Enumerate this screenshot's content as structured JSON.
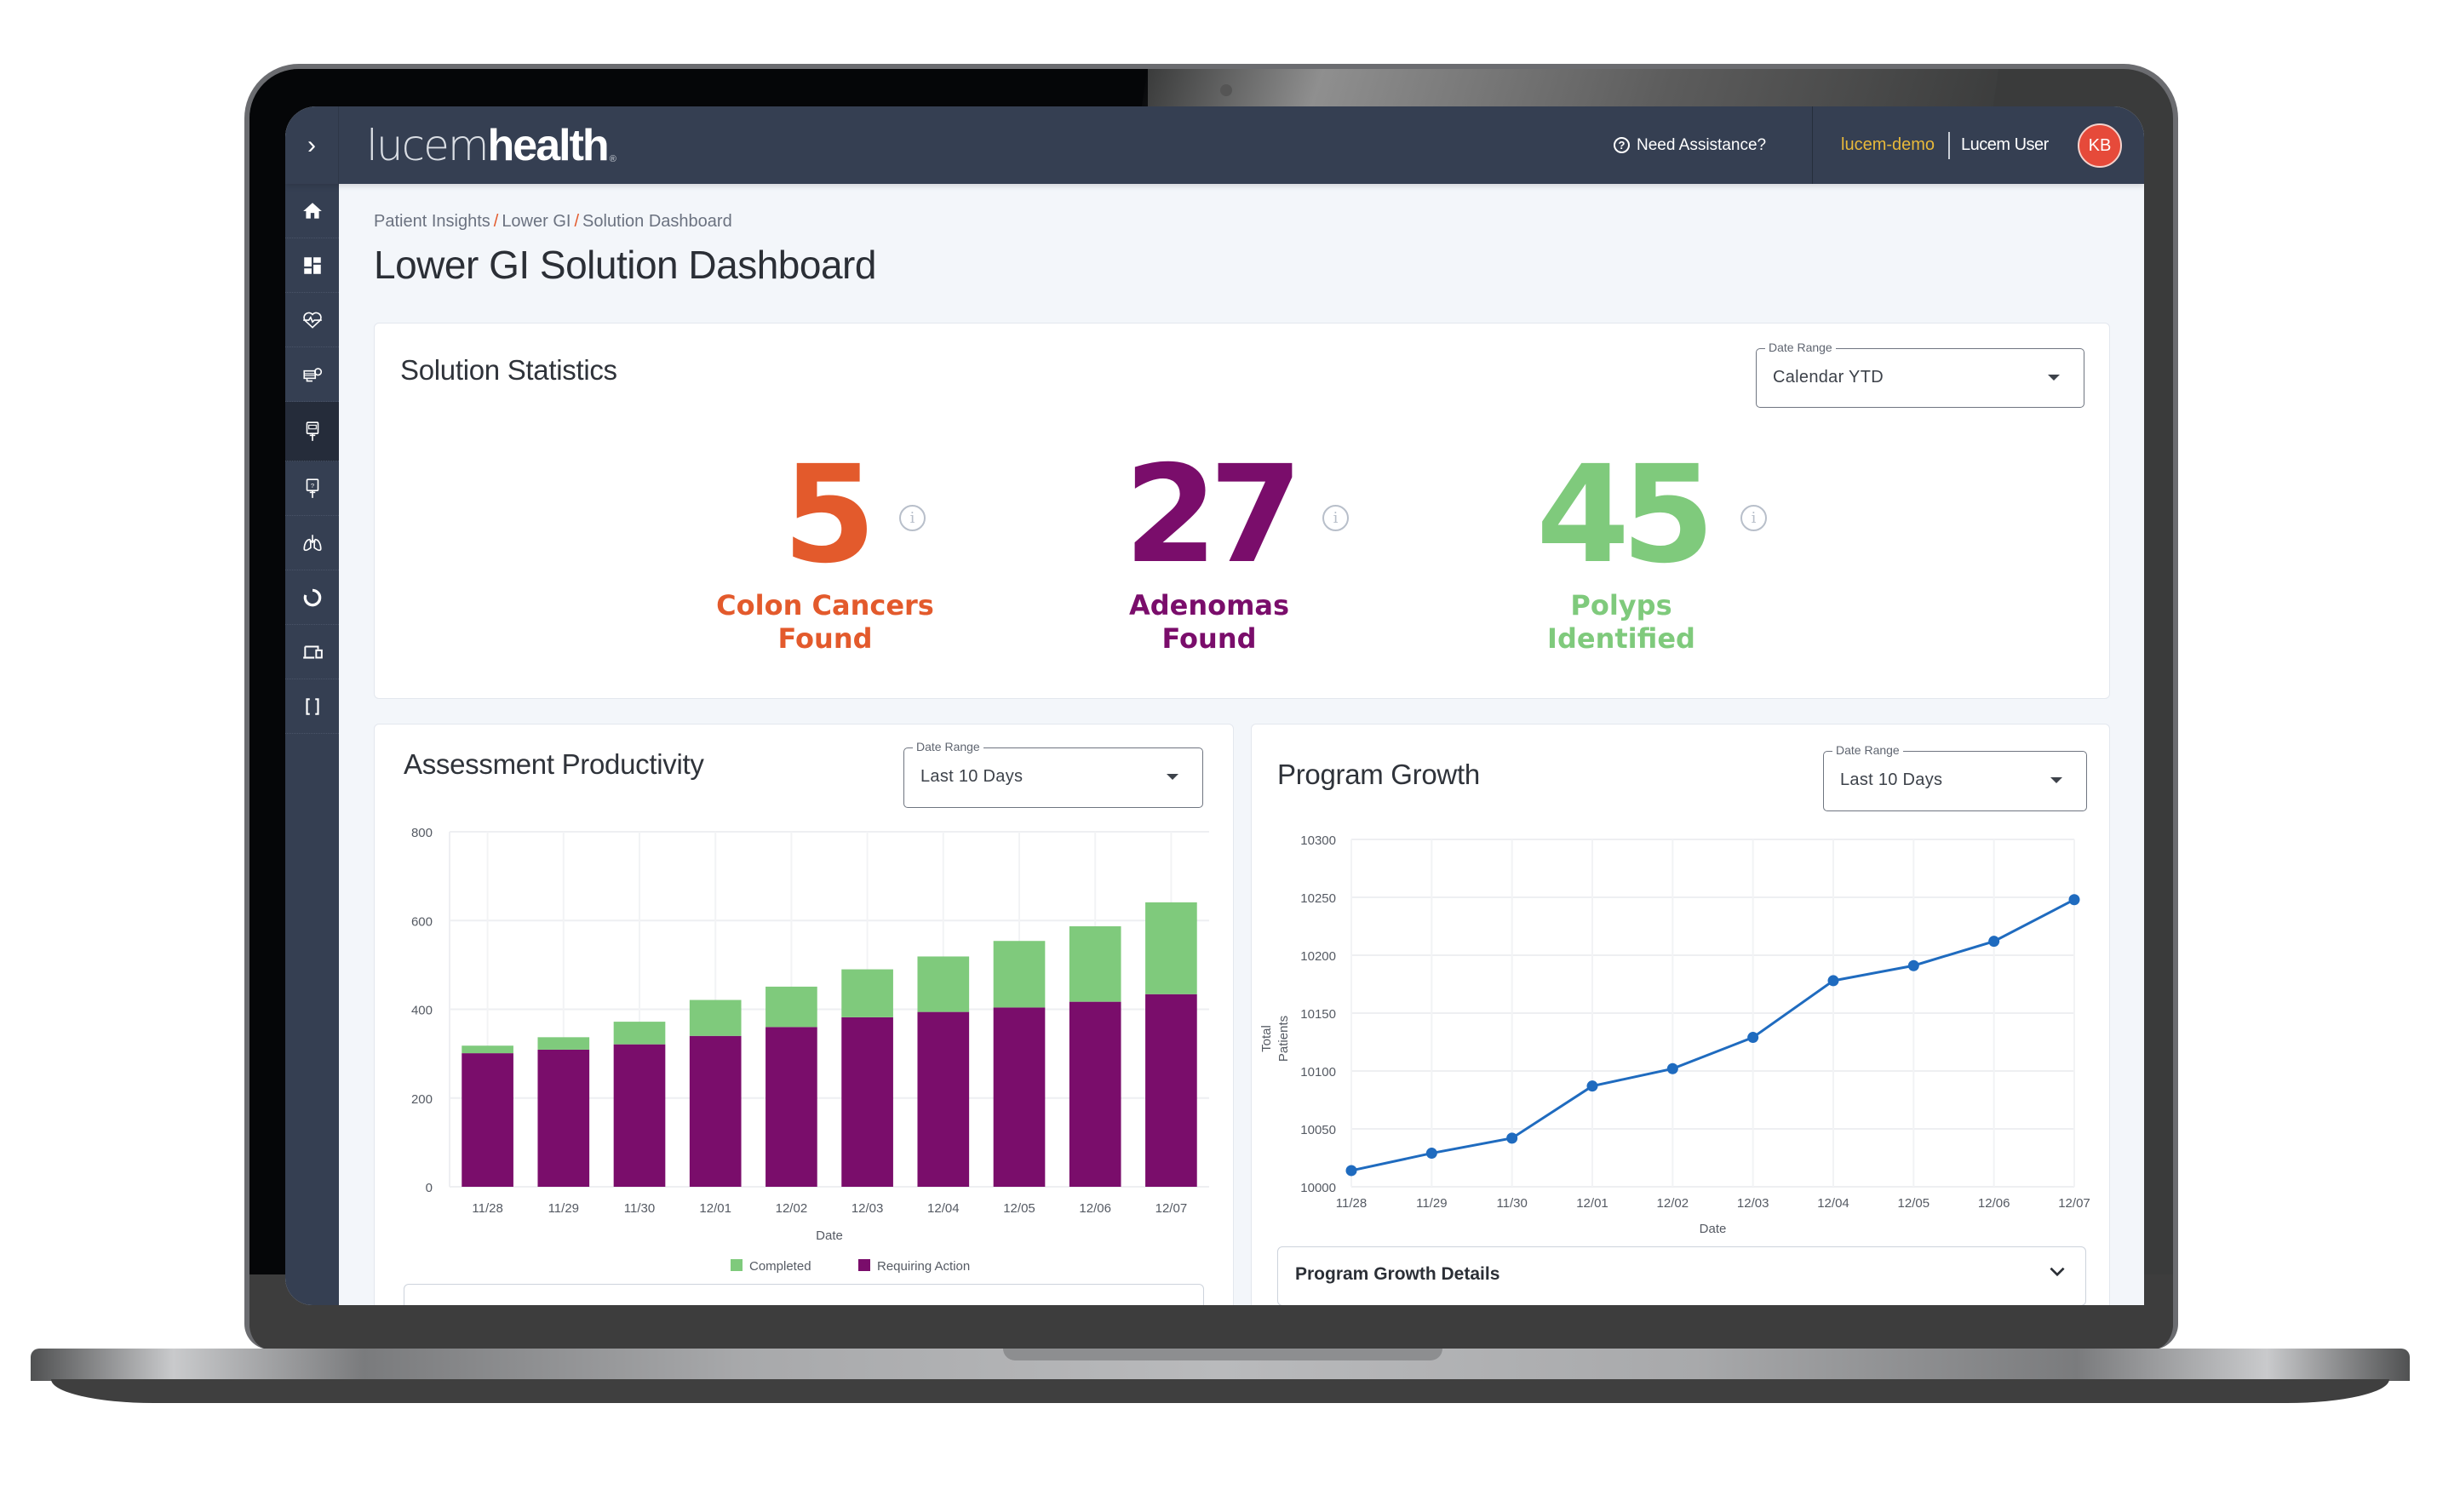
{
  "header": {
    "expand_icon": "chevron-right-icon",
    "logo_light": "lucem",
    "logo_bold": "health",
    "logo_mark": "®",
    "help_label": "Need Assistance?",
    "tenant": "lucem-demo",
    "user_name": "Lucem User",
    "avatar_initials": "KB"
  },
  "sidebar": {
    "items": [
      {
        "icon": "home-icon",
        "active": false
      },
      {
        "icon": "dashboard-icon",
        "active": false
      },
      {
        "icon": "heart-pulse-icon",
        "active": false
      },
      {
        "icon": "infusion-icon",
        "active": false
      },
      {
        "icon": "lower-gi-device-icon",
        "active": true
      },
      {
        "icon": "diagnostic-device-icon",
        "active": false
      },
      {
        "icon": "lungs-icon",
        "active": false
      },
      {
        "icon": "circle-progress-icon",
        "active": false
      },
      {
        "icon": "devices-icon",
        "active": false
      },
      {
        "icon": "brackets-icon",
        "active": false
      }
    ]
  },
  "breadcrumb": [
    "Patient Insights",
    "Lower GI",
    "Solution Dashboard"
  ],
  "breadcrumb_separator": "/",
  "page_title": "Lower GI Solution Dashboard",
  "colors": {
    "header_bg": "#353f52",
    "orange": "#e35a2c",
    "purple": "#7a0d6b",
    "green": "#7fca7c",
    "line_blue": "#1f6bbf",
    "tenant_gold": "#e8b93a",
    "avatar_red": "#e64a3a"
  },
  "solution_statistics": {
    "title": "Solution Statistics",
    "date_range": {
      "label": "Date Range",
      "value": "Calendar YTD"
    },
    "stats": [
      {
        "value": "5",
        "label_line1": "Colon Cancers",
        "label_line2": "Found",
        "color": "#e35a2c"
      },
      {
        "value": "27",
        "label_line1": "Adenomas",
        "label_line2": "Found",
        "color": "#7a0d6b"
      },
      {
        "value": "45",
        "label_line1": "Polyps",
        "label_line2": "Identified",
        "color": "#7fca7c"
      }
    ],
    "info_icon": "i"
  },
  "assessment_productivity": {
    "title": "Assessment Productivity",
    "date_range": {
      "label": "Date Range",
      "value": "Last 10 Days"
    }
  },
  "program_growth": {
    "title": "Program Growth",
    "date_range": {
      "label": "Date Range",
      "value": "Last 10 Days"
    },
    "details_label": "Program Growth Details"
  },
  "chart_data": [
    {
      "type": "bar",
      "stacked": true,
      "title": "Assessment Productivity",
      "xlabel": "Date",
      "ylabel": "",
      "categories": [
        "11/28",
        "11/29",
        "11/30",
        "12/01",
        "12/02",
        "12/03",
        "12/04",
        "12/05",
        "12/06",
        "12/07"
      ],
      "series": [
        {
          "name": "Requiring Action",
          "color": "#7a0d6b",
          "values": [
            301,
            309,
            321,
            340,
            360,
            382,
            394,
            404,
            417,
            434
          ]
        },
        {
          "name": "Completed",
          "color": "#7fca7c",
          "values": [
            17,
            28,
            51,
            81,
            91,
            108,
            125,
            150,
            170,
            207
          ]
        }
      ],
      "legend": [
        "Completed",
        "Requiring Action"
      ],
      "legend_position": "bottom",
      "ylim": [
        0,
        800
      ],
      "yticks": [
        0,
        200,
        400,
        600,
        800
      ],
      "grid": true
    },
    {
      "type": "line",
      "title": "Program Growth",
      "xlabel": "Date",
      "ylabel": "Total Patients",
      "categories": [
        "11/28",
        "11/29",
        "11/30",
        "12/01",
        "12/02",
        "12/03",
        "12/04",
        "12/05",
        "12/06",
        "12/07"
      ],
      "series": [
        {
          "name": "Total Patients",
          "color": "#1f6bbf",
          "values": [
            10014,
            10029,
            10042,
            10087,
            10102,
            10129,
            10178,
            10191,
            10212,
            10248
          ]
        }
      ],
      "ylim": [
        10000,
        10300
      ],
      "yticks": [
        10000,
        10050,
        10100,
        10150,
        10200,
        10250,
        10300
      ],
      "grid": true
    }
  ]
}
